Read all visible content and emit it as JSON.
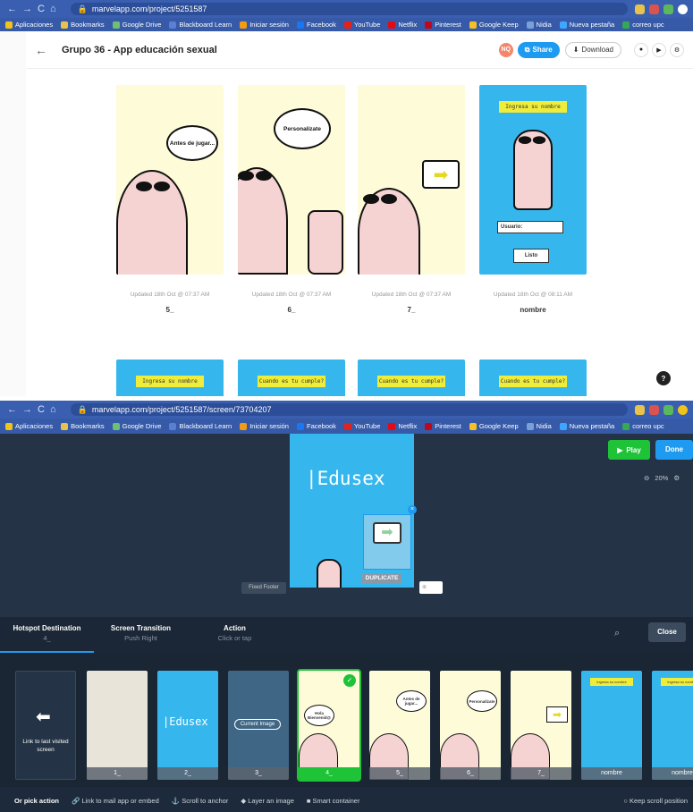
{
  "browser_top": {
    "url": "marvelapp.com/project/5251587",
    "bookmarks": [
      "Aplicaciones",
      "Bookmarks",
      "Google Drive",
      "Blackboard Learn",
      "Iniciar sesión",
      "Facebook",
      "YouTube",
      "Netflix",
      "Pinterest",
      "Google Keep",
      "Nidia",
      "Nueva pestaña",
      "correo upc"
    ]
  },
  "browser_bottom": {
    "url": "marvelapp.com/project/5251587/screen/73704207",
    "bookmarks": [
      "Aplicaciones",
      "Bookmarks",
      "Google Drive",
      "Blackboard Learn",
      "Iniciar sesión",
      "Facebook",
      "YouTube",
      "Netflix",
      "Pinterest",
      "Google Keep",
      "Nidia",
      "Nueva pestaña",
      "correo upc"
    ]
  },
  "project": {
    "title": "Grupo 36 - App educación sexual",
    "avatar_initials": "NQ",
    "share_label": "Share",
    "download_label": "Download"
  },
  "screens": [
    {
      "updated": "Updated 18th Oct @ 07:37 AM",
      "name": "5_",
      "bubble": "Antes de jugar..."
    },
    {
      "updated": "Updated 18th Oct @ 07:37 AM",
      "name": "6_",
      "bubble": "Personalízate"
    },
    {
      "updated": "Updated 18th Oct @ 07:37 AM",
      "name": "7_"
    },
    {
      "updated": "Updated 18th Oct @ 08:11 AM",
      "name": "nombre",
      "label_top": "Ingresa su nombre",
      "field": "Usuario:",
      "button": "Listo"
    }
  ],
  "row2_labels": [
    "Ingresa su nombre",
    "Cuando es tu cumple?",
    "Cuando es tu cumple?",
    "Cuando es tu cumple?"
  ],
  "editor": {
    "play_label": "Play",
    "done_label": "Done",
    "zoom": "20%",
    "screen_title": "|Edusex",
    "hotspot_label": "DUPLICATE",
    "fixed_footer": "Fixed Footer",
    "tabs": [
      {
        "label": "Hotspot Destination",
        "sub": "4_"
      },
      {
        "label": "Screen Transition",
        "sub": "Push Right"
      },
      {
        "label": "Action",
        "sub": "Click or tap"
      }
    ],
    "close_label": "Close",
    "link_last": "Link to last visited screen",
    "thumbs": [
      {
        "cap": "1_"
      },
      {
        "cap": "2_",
        "title": "|Edusex"
      },
      {
        "cap": "3_",
        "current": "Current Image"
      },
      {
        "cap": "4_",
        "bubble": "Hola Bienvenid@"
      },
      {
        "cap": "5_",
        "bubble": "Antes de jugar..."
      },
      {
        "cap": "6_",
        "bubble": "Personalízate"
      },
      {
        "cap": "7_"
      },
      {
        "cap": "nombre",
        "label": "Ingresa su nombre"
      },
      {
        "cap": "nombre",
        "label": "Ingresa su nombre"
      }
    ],
    "or_pick": "Or pick action",
    "actions": [
      "Link to mail app or embed",
      "Scroll to anchor",
      "Layer an image",
      "Smart container"
    ],
    "keep_scroll": "Keep scroll position"
  },
  "colors": {
    "chrome": "#3a5fb0",
    "accent": "#1e9bf0",
    "play": "#1ec337",
    "screen_blue": "#35b7ee",
    "cream": "#fdfbd8",
    "editor_bg": "#1d2a3b"
  }
}
